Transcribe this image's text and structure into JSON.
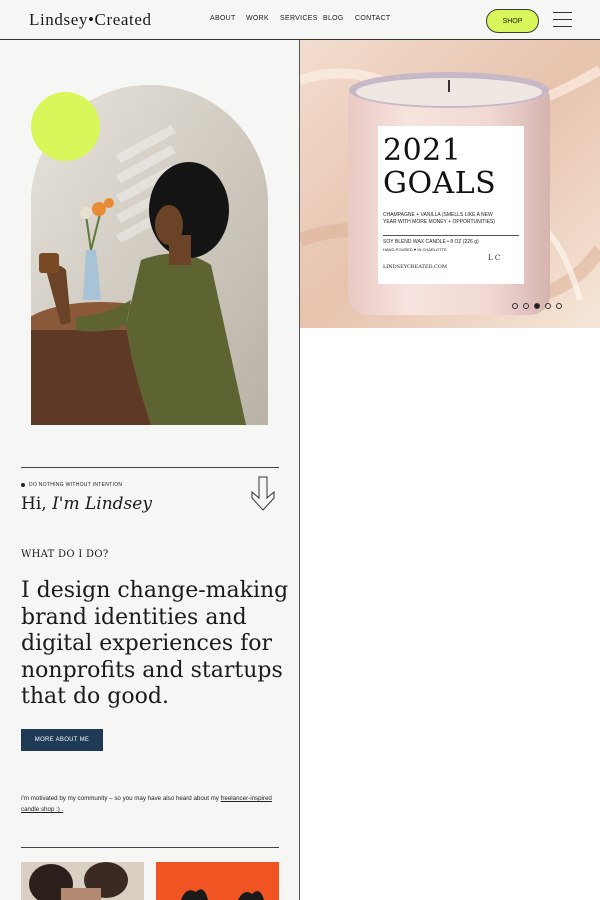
{
  "header": {
    "logo": "Lindsey•Created",
    "nav": [
      "ABOUT",
      "WORK",
      "SERVICES",
      "BLOG",
      "CONTACT"
    ],
    "shop_label": "SHOP"
  },
  "hero": {
    "candle_title_line1": "2021",
    "candle_title_line2": "GOALS",
    "candle_desc_line1": "CHAMPAGNE + VANILLA (SMELLS LIKE A NEW",
    "candle_desc_line2": "YEAR WITH MORE MONEY + OPPORTUNITIES)",
    "candle_detail_line1": "SOY BLEND WAX CANDLE • 8 OZ (226 g)",
    "candle_detail_line2": "HAND-POURED ♥ IN CHARLOTTE",
    "candle_site": "LINDSEYCREATED.COM",
    "candle_monogram": "L C",
    "slides": 5,
    "active_slide": 3
  },
  "intro": {
    "tagline": "DO NOTHING WITHOUT INTENTION",
    "hi": "Hi,",
    "name": "I'm Lindsey",
    "what_heading": "WHAT DO I DO?",
    "headline": "I design change-making brand identities and digital experiences for nonprofits and startups that do good.",
    "more_button": "MORE ABOUT ME",
    "motivated_text": "I'm motivated by my community – so you may have also heard about my ",
    "motivated_link": "freelancer-inspired candle shop :) .",
    "arrow_icon": "arrow-down-icon"
  },
  "colors": {
    "accent": "#d9f75a",
    "navy": "#1f3a55",
    "background": "#f6f6f5"
  }
}
